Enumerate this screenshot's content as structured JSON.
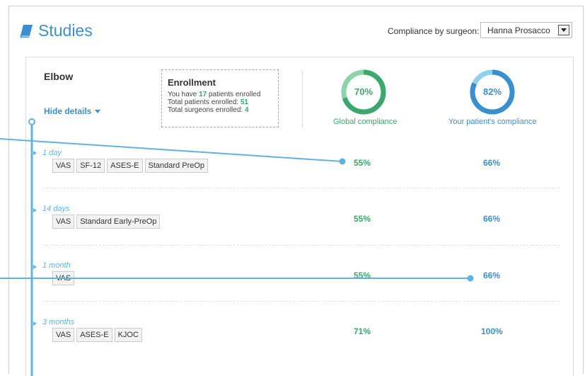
{
  "header": {
    "title": "Studies",
    "icon": "book-icon"
  },
  "surgeon_filter": {
    "label": "Compliance by surgeon:",
    "selected": "Hanna Prosacco"
  },
  "study": {
    "name": "Elbow",
    "hide_details": "Hide details",
    "enrollment": {
      "title": "Enrollment",
      "line1_prefix": "You have ",
      "patients_enrolled": "17",
      "line1_suffix": " patients enrolled",
      "line2_prefix": "Total patients enrolled: ",
      "total_patients": "51",
      "line3_prefix": "Total surgeons enrolled: ",
      "total_surgeons": "4"
    },
    "global_compliance": {
      "value": "70%",
      "label": "Global compliance",
      "fraction": 0.7
    },
    "patient_compliance": {
      "value": "82%",
      "label": "Your patient's compliance",
      "fraction": 0.82
    }
  },
  "rows": [
    {
      "period": "1 day",
      "tags": [
        "VAS",
        "SF-12",
        "ASES-E",
        "Standard PreOp"
      ],
      "global": "55%",
      "yours": "66%"
    },
    {
      "period": "14 days",
      "tags": [
        "VAS",
        "Standard Early-PreOp"
      ],
      "global": "55%",
      "yours": "66%"
    },
    {
      "period": "1 month",
      "tags": [
        "VAS"
      ],
      "global": "55%",
      "yours": "66%"
    },
    {
      "period": "3 months",
      "tags": [
        "VAS",
        "ASES-E",
        "KJOC"
      ],
      "global": "71%",
      "yours": "100%"
    }
  ],
  "colors": {
    "accent": "#3a8fd0",
    "green": "#3aa86a",
    "timeline": "#5fb3e4"
  }
}
